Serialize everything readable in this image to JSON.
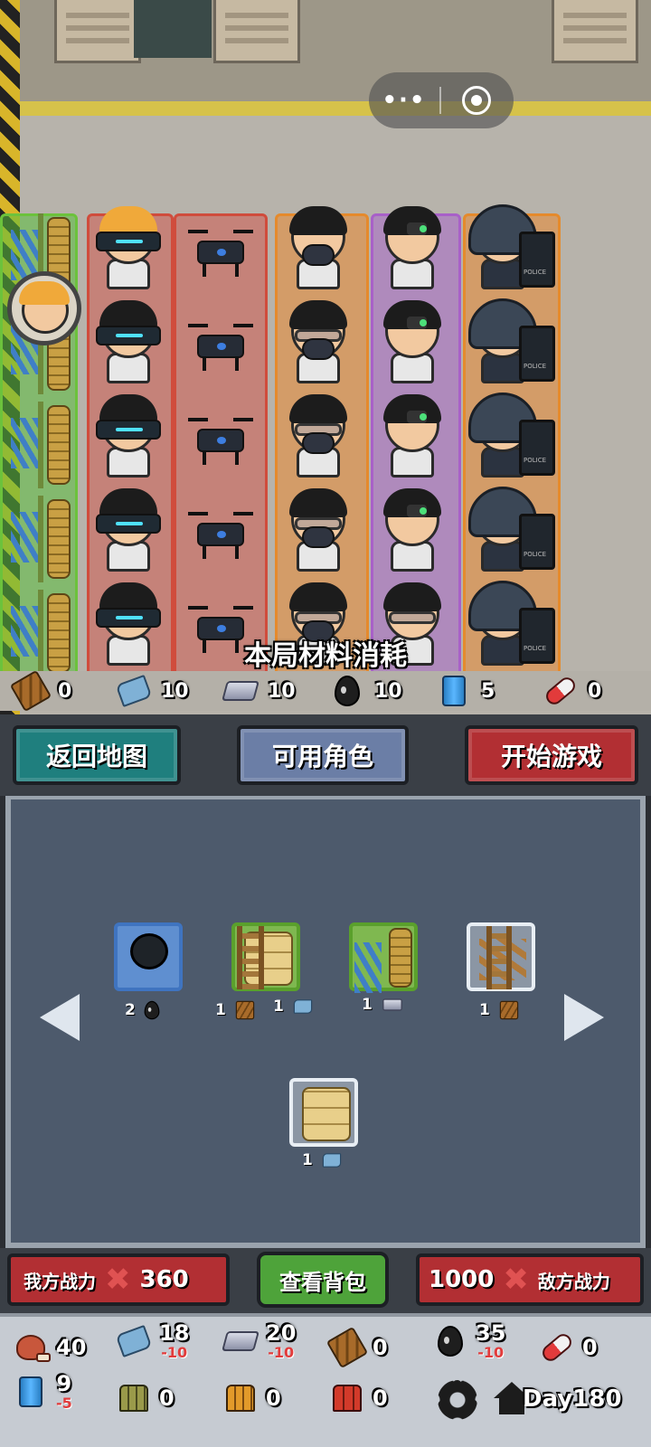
{
  "system_capsule": {
    "menu_glyph": "•·•",
    "close_icon": "record-icon"
  },
  "battlefield": {
    "consume_title": "本局材料消耗",
    "consume": [
      {
        "icon": "wood-plank-icon",
        "value": "0"
      },
      {
        "icon": "cloth-roll-icon",
        "value": "10"
      },
      {
        "icon": "iron-ingot-icon",
        "value": "10"
      },
      {
        "icon": "oil-drop-icon",
        "value": "10"
      },
      {
        "icon": "battery-can-icon",
        "value": "5"
      },
      {
        "icon": "medicine-pill-icon",
        "value": "0"
      }
    ]
  },
  "tabs": {
    "map": "返回地图",
    "roles": "可用角色",
    "start": "开始游戏"
  },
  "roles_panel": {
    "cards": [
      {
        "name": "oil-pot",
        "frame": "blue",
        "costs": [
          {
            "qty": "2",
            "icon": "oil-drop-icon"
          }
        ]
      },
      {
        "name": "sandbag-ladder",
        "frame": "green",
        "costs": [
          {
            "qty": "1",
            "icon": "wood-plank-icon"
          },
          {
            "qty": "1",
            "icon": "cloth-roll-icon"
          }
        ]
      },
      {
        "name": "spike-barrier",
        "frame": "green",
        "costs": [
          {
            "qty": "1",
            "icon": "iron-ingot-icon"
          }
        ]
      },
      {
        "name": "wood-sticks",
        "frame": "white",
        "costs": [
          {
            "qty": "1",
            "icon": "wood-plank-icon"
          }
        ]
      },
      {
        "name": "sandbags",
        "frame": "white",
        "costs": [
          {
            "qty": "1",
            "icon": "cloth-roll-icon"
          }
        ]
      }
    ]
  },
  "actions": {
    "my_power_label": "我方战力",
    "my_power_value": "360",
    "bag_button": "查看背包",
    "enemy_power_value": "1000",
    "enemy_power_label": "敌方战力"
  },
  "inventory": {
    "items": [
      {
        "icon": "meat-icon",
        "value": "40",
        "delta": ""
      },
      {
        "icon": "cloth-roll-icon",
        "value": "18",
        "delta": "-10"
      },
      {
        "icon": "iron-ingot-icon",
        "value": "20",
        "delta": "-10"
      },
      {
        "icon": "wood-plank-icon",
        "value": "0",
        "delta": ""
      },
      {
        "icon": "oil-drop-icon",
        "value": "35",
        "delta": "-10"
      },
      {
        "icon": "medicine-pill-icon",
        "value": "0",
        "delta": ""
      },
      {
        "icon": "battery-can-icon",
        "value": "9",
        "delta": "-5"
      },
      {
        "icon": "ammo-green-icon",
        "value": "0",
        "delta": ""
      },
      {
        "icon": "ammo-orange-icon",
        "value": "0",
        "delta": ""
      },
      {
        "icon": "ammo-red-icon",
        "value": "0",
        "delta": ""
      }
    ],
    "day": "Day180"
  }
}
